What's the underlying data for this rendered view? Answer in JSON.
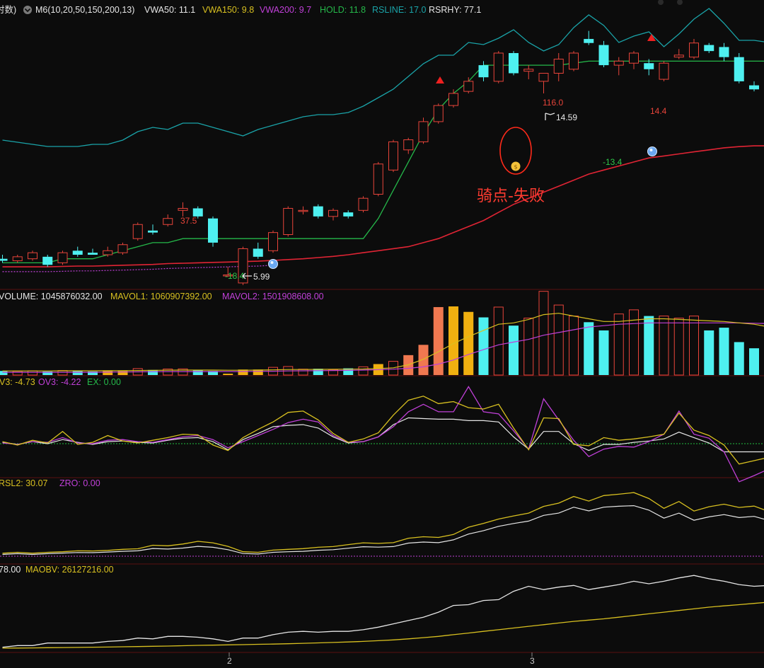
{
  "colors": {
    "bg": "#0c0c0c",
    "separator": "#5a1010",
    "up": "#e8443a",
    "down": "#4ef0f0",
    "cyan_line": "#1aa3a8",
    "green_line": "#25b84a",
    "red_line": "#e02434",
    "purple": "#c040d8",
    "yellow": "#d8c020",
    "white": "#e6e6e6",
    "orange": "#f07850",
    "gold": "#f0b010",
    "green_text": "#2ec84a",
    "annot": "#ff3b30"
  },
  "legends": {
    "main": [
      {
        "text": "时数)",
        "color": "#e6e6e6"
      },
      {
        "text": "M6(10,20,50,150,200,13)",
        "color": "#e6e6e6"
      },
      {
        "text": "VWA50: 11.1",
        "color": "#e6e6e6"
      },
      {
        "text": "VWA150: 9.8",
        "color": "#d8c020"
      },
      {
        "text": "VWA200: 9.7",
        "color": "#c040d8"
      },
      {
        "text": "HOLD: 11.8",
        "color": "#25b84a"
      },
      {
        "text": "RSLINE: 17.0",
        "color": "#1aa3a8"
      },
      {
        "text": "RSRHY: 77.1",
        "color": "#e6e6e6"
      }
    ],
    "volume": [
      {
        "text": "VOLUME: 1045876032.00",
        "color": "#e6e6e6"
      },
      {
        "text": "MAVOL1: 1060907392.00",
        "color": "#d8c020"
      },
      {
        "text": "MAVOL2: 1501908608.00",
        "color": "#c040d8"
      }
    ],
    "osc": [
      {
        "text": "V3: -4.73",
        "color": "#d8c020"
      },
      {
        "text": "OV3: -4.22",
        "color": "#c040d8"
      },
      {
        "text": "EX: 0.00",
        "color": "#25b84a"
      }
    ],
    "rs": [
      {
        "text": "RSL2: 30.07",
        "color": "#d8c020"
      },
      {
        "text": "ZRO: 0.00",
        "color": "#c040d8"
      }
    ],
    "obv": [
      {
        "text": "78.00",
        "color": "#e6e6e6"
      },
      {
        "text": "MAOBV: 26127216.00",
        "color": "#d8c020"
      }
    ]
  },
  "annotations": {
    "peak_1": "37.5",
    "low_1": "-18.4",
    "low_1_price": "5.99",
    "peak_2": "116.0",
    "peak_2_price": "14.59",
    "peak_3": "14.4",
    "low_2": "-13.4",
    "note": "骑点-失败",
    "month_labels": [
      "2",
      "3"
    ]
  },
  "chart_data": {
    "type": "candlestick",
    "candles": [
      {
        "o": 8.9,
        "h": 9.0,
        "l": 8.8,
        "c": 8.85
      },
      {
        "o": 8.85,
        "h": 9.0,
        "l": 8.8,
        "c": 8.95
      },
      {
        "o": 8.9,
        "h": 9.1,
        "l": 8.85,
        "c": 9.05
      },
      {
        "o": 8.95,
        "h": 9.0,
        "l": 8.7,
        "c": 8.75
      },
      {
        "o": 8.8,
        "h": 9.1,
        "l": 8.75,
        "c": 9.05
      },
      {
        "o": 9.1,
        "h": 9.2,
        "l": 8.95,
        "c": 9.0
      },
      {
        "o": 9.05,
        "h": 9.15,
        "l": 9.0,
        "c": 9.0
      },
      {
        "o": 9.0,
        "h": 9.2,
        "l": 8.95,
        "c": 9.1
      },
      {
        "o": 9.05,
        "h": 9.3,
        "l": 9.0,
        "c": 9.25
      },
      {
        "o": 9.4,
        "h": 9.8,
        "l": 9.35,
        "c": 9.75
      },
      {
        "o": 9.6,
        "h": 9.75,
        "l": 9.5,
        "c": 9.55
      },
      {
        "o": 9.75,
        "h": 10.0,
        "l": 9.7,
        "c": 9.9
      },
      {
        "o": 10.1,
        "h": 10.3,
        "l": 9.95,
        "c": 10.15
      },
      {
        "o": 10.15,
        "h": 10.2,
        "l": 9.9,
        "c": 9.95
      },
      {
        "o": 9.9,
        "h": 9.95,
        "l": 9.2,
        "c": 9.3
      },
      {
        "o": 8.5,
        "h": 8.7,
        "l": 8.45,
        "c": 8.5
      },
      {
        "o": 8.3,
        "h": 9.2,
        "l": 8.25,
        "c": 9.15
      },
      {
        "o": 9.15,
        "h": 9.3,
        "l": 8.9,
        "c": 8.95
      },
      {
        "o": 9.1,
        "h": 9.6,
        "l": 9.05,
        "c": 9.55
      },
      {
        "o": 9.5,
        "h": 10.2,
        "l": 9.45,
        "c": 10.15
      },
      {
        "o": 10.1,
        "h": 10.2,
        "l": 10.0,
        "c": 10.1
      },
      {
        "o": 10.2,
        "h": 10.25,
        "l": 9.9,
        "c": 9.95
      },
      {
        "o": 9.95,
        "h": 10.15,
        "l": 9.85,
        "c": 10.1
      },
      {
        "o": 10.05,
        "h": 10.1,
        "l": 9.9,
        "c": 9.95
      },
      {
        "o": 10.1,
        "h": 10.45,
        "l": 10.05,
        "c": 10.4
      },
      {
        "o": 10.5,
        "h": 11.3,
        "l": 10.45,
        "c": 11.25
      },
      {
        "o": 11.1,
        "h": 11.85,
        "l": 11.05,
        "c": 11.8
      },
      {
        "o": 11.6,
        "h": 11.9,
        "l": 11.5,
        "c": 11.85
      },
      {
        "o": 11.8,
        "h": 12.4,
        "l": 11.75,
        "c": 12.3
      },
      {
        "o": 12.3,
        "h": 12.75,
        "l": 12.25,
        "c": 12.7
      },
      {
        "o": 12.7,
        "h": 13.1,
        "l": 12.65,
        "c": 13.0
      },
      {
        "o": 13.05,
        "h": 13.4,
        "l": 13.0,
        "c": 13.3
      },
      {
        "o": 13.7,
        "h": 13.8,
        "l": 13.3,
        "c": 13.4
      },
      {
        "o": 13.3,
        "h": 14.05,
        "l": 13.25,
        "c": 14.0
      },
      {
        "o": 14.0,
        "h": 14.05,
        "l": 13.45,
        "c": 13.5
      },
      {
        "o": 13.55,
        "h": 13.7,
        "l": 13.35,
        "c": 13.6
      },
      {
        "o": 13.3,
        "h": 13.5,
        "l": 13.0,
        "c": 13.5
      },
      {
        "o": 13.5,
        "h": 14.0,
        "l": 13.3,
        "c": 13.85
      },
      {
        "o": 13.6,
        "h": 14.05,
        "l": 13.55,
        "c": 14.0
      },
      {
        "o": 14.35,
        "h": 14.55,
        "l": 14.2,
        "c": 14.25
      },
      {
        "o": 14.2,
        "h": 14.3,
        "l": 13.65,
        "c": 13.7
      },
      {
        "o": 13.7,
        "h": 13.9,
        "l": 13.45,
        "c": 13.8
      },
      {
        "o": 13.75,
        "h": 14.05,
        "l": 13.6,
        "c": 14.0
      },
      {
        "o": 13.75,
        "h": 13.85,
        "l": 13.45,
        "c": 13.6
      },
      {
        "o": 13.35,
        "h": 13.8,
        "l": 13.3,
        "c": 13.75
      },
      {
        "o": 13.9,
        "h": 14.1,
        "l": 13.85,
        "c": 13.95
      },
      {
        "o": 13.9,
        "h": 14.35,
        "l": 13.85,
        "c": 14.25
      },
      {
        "o": 14.2,
        "h": 14.25,
        "l": 14.0,
        "c": 14.05
      },
      {
        "o": 14.15,
        "h": 14.25,
        "l": 13.8,
        "c": 13.9
      },
      {
        "o": 13.9,
        "h": 14.0,
        "l": 13.25,
        "c": 13.3
      },
      {
        "o": 13.2,
        "h": 13.3,
        "l": 13.05,
        "c": 13.1
      },
      {
        "o": 13.1,
        "h": 13.35,
        "l": 13.05,
        "c": 13.3
      },
      {
        "o": 13.3,
        "h": 13.35,
        "l": 12.6,
        "c": 12.65
      },
      {
        "o": 12.65,
        "h": 12.9,
        "l": 12.25,
        "c": 12.4
      }
    ],
    "rsline": [
      14.5,
      14.45,
      14.4,
      14.35,
      14.35,
      14.35,
      14.4,
      14.4,
      14.5,
      14.7,
      14.8,
      14.75,
      14.9,
      14.9,
      14.8,
      14.7,
      14.6,
      14.75,
      14.85,
      14.95,
      15.05,
      15.1,
      15.1,
      15.15,
      15.3,
      15.5,
      15.7,
      16.0,
      16.3,
      16.5,
      16.5,
      16.8,
      16.75,
      16.9,
      17.1,
      16.8,
      16.6,
      16.75,
      17.15,
      17.45,
      17.2,
      16.8,
      16.95,
      17.05,
      16.7,
      17.0,
      17.35,
      17.6,
      17.25,
      16.85,
      16.85,
      16.8,
      16.45,
      16.5
    ],
    "hold": [
      8.8,
      8.8,
      8.8,
      8.8,
      8.9,
      8.9,
      8.9,
      9.0,
      9.1,
      9.2,
      9.3,
      9.3,
      9.4,
      9.4,
      9.4,
      9.4,
      9.4,
      9.4,
      9.4,
      9.4,
      9.4,
      9.4,
      9.4,
      9.4,
      9.4,
      9.9,
      10.6,
      11.3,
      12.0,
      12.6,
      13.0,
      13.3,
      13.7,
      13.7,
      13.7,
      13.7,
      13.7,
      13.7,
      13.75,
      13.8,
      13.8,
      13.8,
      13.8,
      13.8,
      13.8,
      13.8,
      13.8,
      13.8,
      13.8,
      13.8,
      13.8,
      13.8,
      13.7,
      13.4
    ],
    "vwa200": [
      8.7,
      8.7,
      8.7,
      8.7,
      8.71,
      8.72,
      8.72,
      8.73,
      8.74,
      8.75,
      8.76,
      8.78,
      8.79,
      8.8,
      8.81,
      8.82,
      8.83,
      8.84,
      8.86,
      8.88,
      8.9,
      8.93,
      8.96,
      9.0,
      9.05,
      9.1,
      9.15,
      9.2,
      9.3,
      9.4,
      9.55,
      9.7,
      9.85,
      10.05,
      10.25,
      10.4,
      10.55,
      10.7,
      10.85,
      11.0,
      11.1,
      11.2,
      11.3,
      11.4,
      11.45,
      11.5,
      11.55,
      11.6,
      11.65,
      11.68,
      11.7,
      11.7,
      11.7,
      11.7
    ],
    "volume": [
      60,
      55,
      62,
      52,
      66,
      58,
      52,
      60,
      60,
      94,
      74,
      88,
      90,
      70,
      60,
      20,
      80,
      80,
      112,
      124,
      86,
      92,
      78,
      98,
      120,
      160,
      200,
      290,
      440,
      990,
      1000,
      920,
      840,
      990,
      720,
      830,
      1220,
      1020,
      860,
      770,
      650,
      890,
      950,
      860,
      860,
      830,
      860,
      650,
      690,
      480,
      390,
      380,
      260,
      280
    ],
    "mavol1": [
      60,
      60,
      60,
      60,
      62,
      62,
      62,
      63,
      64,
      66,
      68,
      70,
      72,
      72,
      72,
      70,
      70,
      72,
      75,
      80,
      80,
      82,
      84,
      86,
      88,
      95,
      105,
      150,
      230,
      340,
      460,
      560,
      650,
      740,
      760,
      810,
      880,
      900,
      860,
      820,
      780,
      780,
      800,
      820,
      820,
      810,
      800,
      790,
      780,
      760,
      740,
      700,
      660,
      620
    ],
    "mavol2": [
      40,
      40,
      40,
      40,
      40,
      40,
      40,
      42,
      44,
      46,
      48,
      50,
      50,
      50,
      50,
      50,
      52,
      54,
      56,
      60,
      62,
      64,
      66,
      68,
      72,
      78,
      86,
      98,
      120,
      160,
      220,
      300,
      370,
      440,
      480,
      520,
      580,
      620,
      660,
      700,
      720,
      740,
      750,
      760,
      760,
      760,
      760,
      760,
      760,
      760,
      755,
      750,
      740,
      730
    ],
    "v3": [
      0.3,
      -0.2,
      0.5,
      0.1,
      1.8,
      -0.1,
      0.2,
      1.2,
      0.4,
      0.1,
      0.5,
      0.9,
      1.4,
      1.3,
      -0.2,
      -1.0,
      0.9,
      2.1,
      3.2,
      4.6,
      4.8,
      3.5,
      1.5,
      0.2,
      0.7,
      1.6,
      4.2,
      6.4,
      7.0,
      5.9,
      6.2,
      5.3,
      5.1,
      5.8,
      2.3,
      -0.9,
      3.8,
      3.7,
      -0.1,
      -0.3,
      0.9,
      0.5,
      0.7,
      1.0,
      1.4,
      4.5,
      2.0,
      1.2,
      -0.2,
      -3.0,
      -2.5,
      -2.0,
      -4.0,
      -5.5
    ],
    "ov3": [
      0.1,
      -0.1,
      0.3,
      0.2,
      0.9,
      0.1,
      0.0,
      0.5,
      0.6,
      0.3,
      0.2,
      0.6,
      1.0,
      1.2,
      0.6,
      -0.6,
      0.3,
      1.2,
      2.1,
      3.1,
      3.6,
      3.2,
      1.2,
      0.2,
      0.3,
      1.0,
      2.5,
      4.7,
      5.8,
      4.7,
      4.7,
      8.4,
      4.7,
      4.4,
      1.9,
      -0.8,
      6.6,
      3.5,
      0.5,
      -1.9,
      -0.8,
      -0.4,
      -0.5,
      0.3,
      1.4,
      4.8,
      1.4,
      0.8,
      -1.2,
      -5.6,
      -4.7,
      -3.7,
      -3.0,
      -4.8
    ],
    "ex_white": [
      0.2,
      -0.1,
      0.3,
      0.0,
      0.6,
      0.2,
      -0.1,
      0.3,
      0.4,
      0.2,
      0.1,
      0.5,
      0.8,
      0.9,
      0.3,
      -0.9,
      0.6,
      1.5,
      2.5,
      2.7,
      2.8,
      2.3,
      1.0,
      0.1,
      0.3,
      1.0,
      2.8,
      3.8,
      3.7,
      3.6,
      3.6,
      3.4,
      3.4,
      3.2,
      1.0,
      -0.8,
      1.8,
      1.8,
      0.0,
      -1.0,
      -0.1,
      -0.1,
      0.2,
      0.4,
      0.7,
      1.7,
      0.9,
      0.1,
      -1.2,
      -1.2,
      -1.2,
      -1.2,
      -0.1,
      -1.4
    ],
    "rsl2": [
      2.0,
      2.6,
      2.0,
      2.6,
      3.0,
      3.6,
      3.5,
      3.9,
      4.6,
      5.0,
      7.4,
      7.0,
      8.2,
      10.0,
      9.0,
      6.6,
      3.0,
      2.6,
      4.1,
      4.6,
      5.1,
      6.0,
      6.5,
      7.8,
      9.0,
      8.6,
      9.1,
      12.1,
      13.1,
      12.6,
      14.6,
      19.5,
      22.1,
      25.0,
      27.1,
      29.0,
      33.5,
      35.7,
      40.2,
      37.1,
      40.8,
      41.7,
      42.8,
      38.8,
      32.2,
      36.8,
      30.4,
      33.3,
      35.0,
      32.8,
      33.7,
      30.0,
      27.0,
      30.1
    ],
    "rsl_white": [
      1.2,
      1.7,
      1.2,
      1.7,
      2.1,
      2.5,
      2.4,
      2.8,
      3.3,
      3.6,
      5.2,
      4.8,
      5.5,
      6.6,
      6.0,
      4.4,
      1.8,
      1.5,
      2.6,
      3.0,
      3.3,
      4.0,
      4.4,
      5.4,
      6.4,
      6.1,
      6.5,
      8.8,
      9.5,
      9.1,
      11.0,
      14.9,
      17.2,
      20.1,
      22.0,
      23.6,
      27.5,
      29.0,
      33.0,
      30.5,
      33.0,
      33.6,
      34.0,
      31.0,
      25.6,
      29.0,
      24.2,
      26.5,
      28.0,
      26.0,
      26.8,
      24.0,
      21.6,
      24.0
    ],
    "obv": [
      0.2,
      0.4,
      0.4,
      0.7,
      0.7,
      0.7,
      0.7,
      0.9,
      1.0,
      1.3,
      1.2,
      1.5,
      1.5,
      1.4,
      1.2,
      0.9,
      1.3,
      1.3,
      1.7,
      2.0,
      2.1,
      2.0,
      2.1,
      2.1,
      2.3,
      2.6,
      3.0,
      3.4,
      3.8,
      4.4,
      5.2,
      5.3,
      5.8,
      5.9,
      6.9,
      7.5,
      7.1,
      7.4,
      7.6,
      7.1,
      7.4,
      7.7,
      8.1,
      7.8,
      8.1,
      8.5,
      8.8,
      8.4,
      8.1,
      7.7,
      7.5,
      7.6,
      7.2,
      6.9
    ],
    "maobv": [
      0.1,
      0.1,
      0.12,
      0.14,
      0.16,
      0.18,
      0.2,
      0.22,
      0.25,
      0.28,
      0.31,
      0.34,
      0.38,
      0.42,
      0.45,
      0.48,
      0.51,
      0.55,
      0.58,
      0.62,
      0.67,
      0.72,
      0.77,
      0.83,
      0.9,
      0.98,
      1.08,
      1.2,
      1.35,
      1.5,
      1.7,
      1.9,
      2.1,
      2.3,
      2.5,
      2.7,
      2.9,
      3.1,
      3.3,
      3.45,
      3.6,
      3.8,
      4.0,
      4.2,
      4.4,
      4.6,
      4.8,
      5.0,
      5.15,
      5.3,
      5.45,
      5.6,
      5.6,
      5.6
    ]
  }
}
